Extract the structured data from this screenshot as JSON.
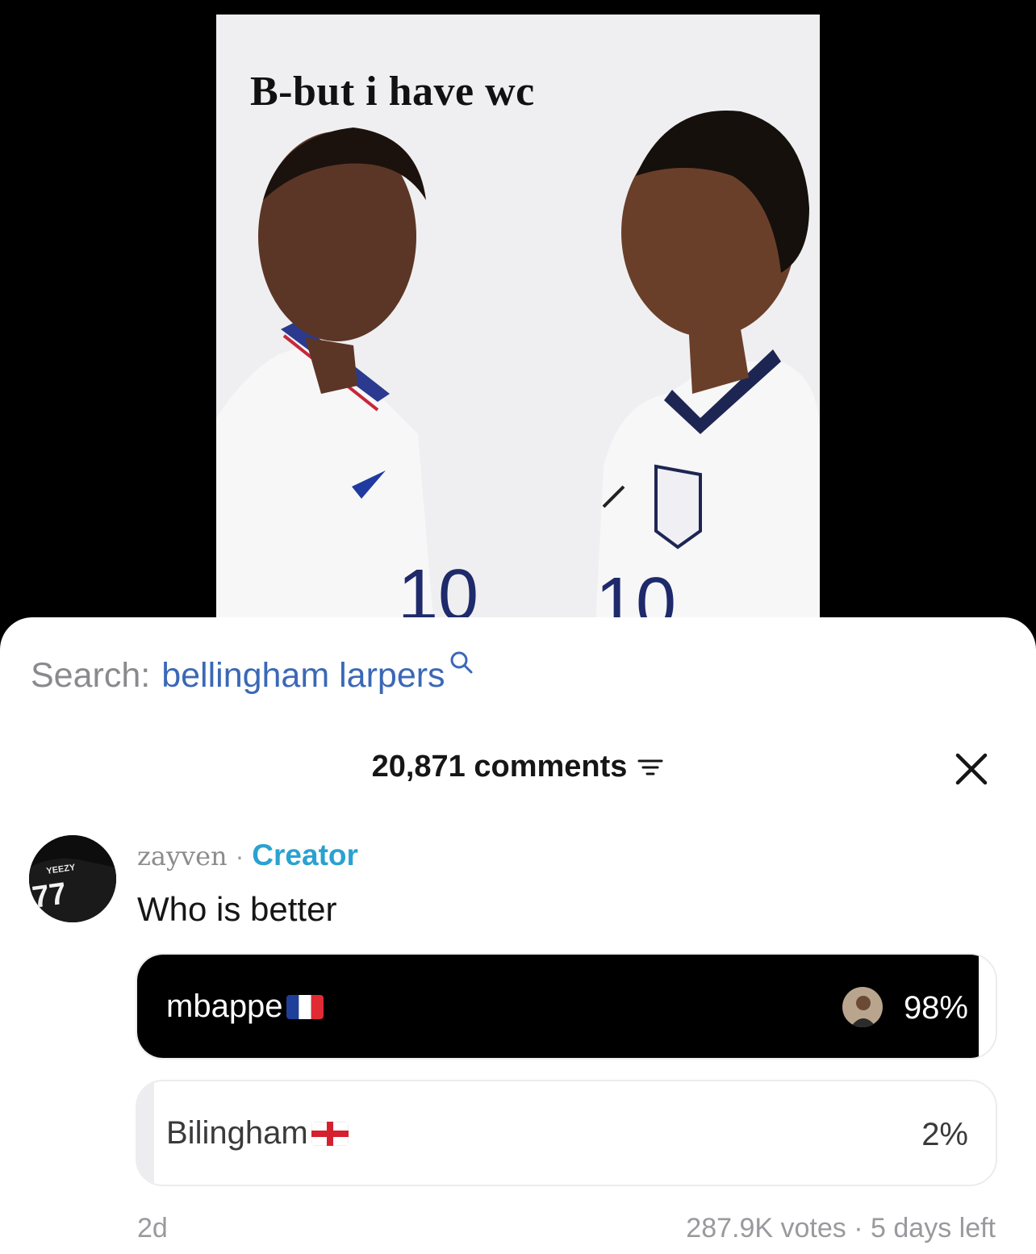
{
  "video": {
    "caption": "B-but i have wc"
  },
  "search": {
    "prefix": "Search:",
    "term": "bellingham larpers",
    "icon": "search-icon"
  },
  "comments": {
    "count_label": "20,871 comments",
    "filter_icon": "filter-icon",
    "close_icon": "close-icon"
  },
  "comment": {
    "author": "zayven",
    "separator": "·",
    "badge": "Creator",
    "text": "Who is better",
    "avatar_text": [
      "YEEZY",
      "77"
    ],
    "posted": "2d"
  },
  "poll": {
    "options": [
      {
        "label": "mbappe",
        "flag": "france-flag",
        "percent_label": "98%",
        "percent": 98,
        "selected": true
      },
      {
        "label": "Bilingham",
        "flag": "england-flag",
        "percent_label": "2%",
        "percent": 2,
        "selected": false
      }
    ],
    "votes": "287.9K votes",
    "separator": "·",
    "time_left": "5 days left"
  },
  "colors": {
    "creator": "#2aa2d0",
    "search_term": "#3b68b6",
    "selected_fill": "#000000",
    "muted": "#9a9a9e"
  }
}
